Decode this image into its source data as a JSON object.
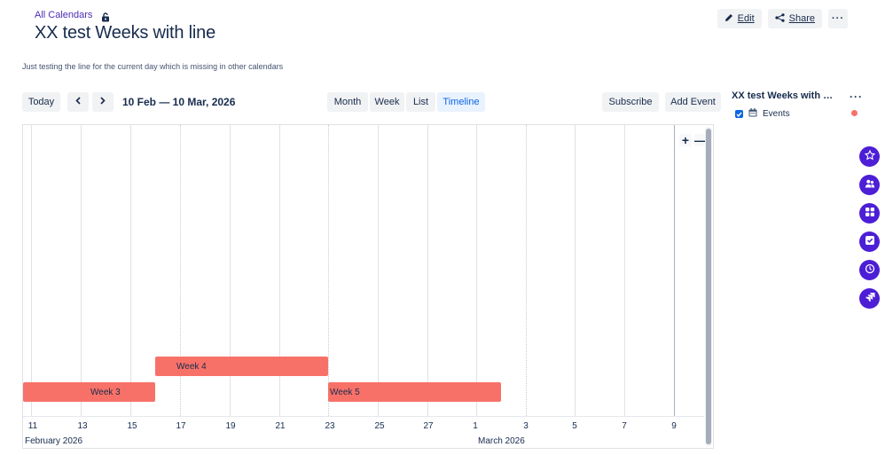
{
  "breadcrumb": {
    "link": "All Calendars",
    "lock_icon": "lock-icon"
  },
  "page": {
    "title": "XX test Weeks with line",
    "description": "Just testing the line for the current day which is missing in other calendars"
  },
  "actions": {
    "edit": "Edit",
    "share": "Share",
    "more": "···"
  },
  "toolbar": {
    "today": "Today",
    "prev_icon": "chevron-left-icon",
    "next_icon": "chevron-right-icon",
    "range": "10 Feb — 10 Mar, 2026",
    "views": [
      "Month",
      "Week",
      "List",
      "Timeline"
    ],
    "active_view": "Timeline",
    "subscribe": "Subscribe",
    "add_event": "Add Event"
  },
  "timeline": {
    "ticks": [
      "11",
      "13",
      "15",
      "17",
      "19",
      "21",
      "23",
      "25",
      "27",
      "1",
      "3",
      "5",
      "7",
      "9"
    ],
    "months": [
      "February 2026",
      "March 2026"
    ],
    "events": [
      {
        "label": "Week 4",
        "color": "#f87168"
      },
      {
        "label": "Week 3",
        "color": "#f87168"
      },
      {
        "label": "Week 5",
        "color": "#f87168"
      }
    ],
    "zoom_in": "+",
    "zoom_out": "—"
  },
  "sidebar": {
    "title": "XX test Weeks with l...",
    "more": "···",
    "calendars": [
      {
        "name": "Events",
        "checked": true,
        "color": "#f87168"
      }
    ]
  },
  "right_rail": {
    "icons": [
      "star-icon",
      "people-icon",
      "grid-icon",
      "checkbox-icon",
      "clock-icon",
      "jira-icon"
    ],
    "color": "#4c1ed6"
  }
}
